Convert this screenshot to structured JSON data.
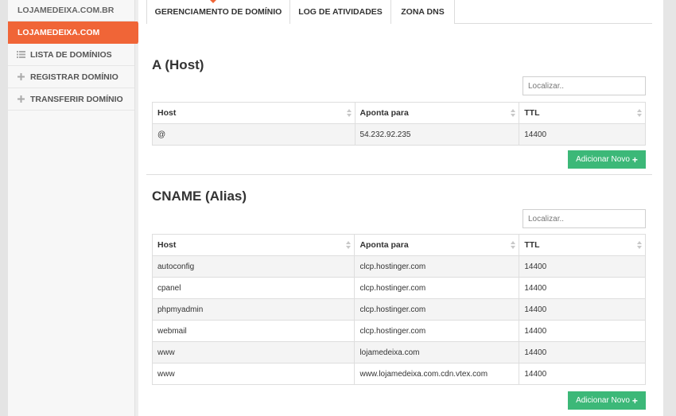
{
  "sidebar": {
    "items": [
      {
        "label": "LOJAMEDEIXA.COM.BR"
      },
      {
        "label": "LOJAMEDEIXA.COM"
      },
      {
        "label": "LISTA DE DOMÍNIOS",
        "icon": "list-icon"
      },
      {
        "label": "REGISTRAR DOMÍNIO",
        "icon": "plus-icon"
      },
      {
        "label": "TRANSFERIR DOMÍNIO",
        "icon": "plus-icon"
      }
    ]
  },
  "tabs": [
    {
      "label": "GERENCIAMENTO DE DOMÍNIO"
    },
    {
      "label": "LOG DE ATIVIDADES"
    },
    {
      "label": "ZONA DNS"
    }
  ],
  "a_host": {
    "title": "A (Host)",
    "search_placeholder": "Localizar..",
    "columns": [
      "Host",
      "Aponta para",
      "TTL"
    ],
    "rows": [
      {
        "host": "@",
        "points_to": "54.232.92.235",
        "ttl": "14400"
      }
    ],
    "add_label": "Adicionar Novo"
  },
  "cname": {
    "title": "CNAME (Alias)",
    "search_placeholder": "Localizar..",
    "columns": [
      "Host",
      "Aponta para",
      "TTL"
    ],
    "rows": [
      {
        "host": "autoconfig",
        "points_to": "clcp.hostinger.com",
        "ttl": "14400"
      },
      {
        "host": "cpanel",
        "points_to": "clcp.hostinger.com",
        "ttl": "14400"
      },
      {
        "host": "phpmyadmin",
        "points_to": "clcp.hostinger.com",
        "ttl": "14400"
      },
      {
        "host": "webmail",
        "points_to": "clcp.hostinger.com",
        "ttl": "14400"
      },
      {
        "host": "www",
        "points_to": "lojamedeixa.com",
        "ttl": "14400"
      },
      {
        "host": "www",
        "points_to": "www.lojamedeixa.com.cdn.vtex.com",
        "ttl": "14400"
      }
    ],
    "add_label": "Adicionar Novo"
  },
  "colors": {
    "accent": "#f06537",
    "button": "#3cb878"
  }
}
